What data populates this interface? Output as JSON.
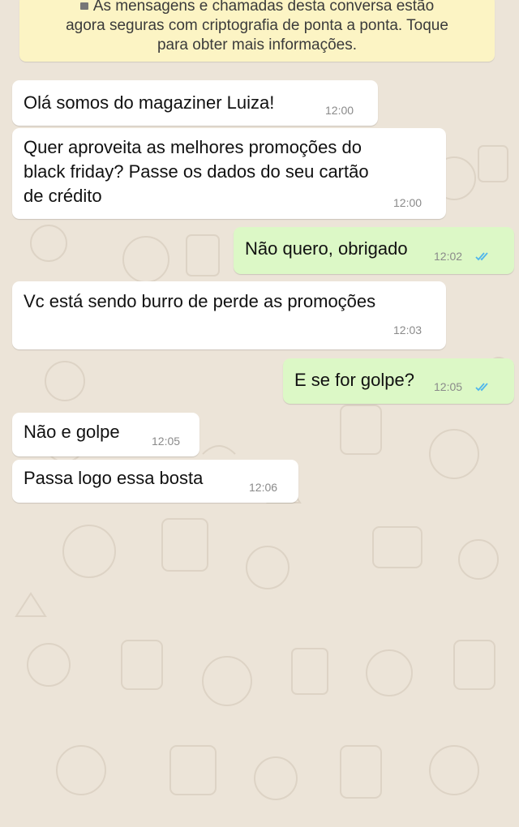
{
  "encryption_notice": {
    "line1": "As mensagens e chamadas desta conversa estão",
    "line2": "agora seguras com criptografia de ponta a ponta. Toque",
    "line3": "para obter mais informações."
  },
  "messages": [
    {
      "direction": "in",
      "text": "Olá somos do magaziner Luiza!",
      "time": "12:00"
    },
    {
      "direction": "in",
      "text": "Quer aproveita as melhores promoções do\nblack friday? Passe os dados do seu cartão\nde crédito",
      "time": "12:00"
    },
    {
      "direction": "out",
      "text": "Não quero, obrigado",
      "time": "12:02",
      "status": "read-ticks-icon"
    },
    {
      "direction": "in",
      "text": "Vc está sendo burro de perde as promoções",
      "time": "12:03"
    },
    {
      "direction": "out",
      "text": "E se for golpe?",
      "time": "12:05",
      "status": "read-ticks-icon"
    },
    {
      "direction": "in",
      "text": "Não e golpe",
      "time": "12:05"
    },
    {
      "direction": "in",
      "text": "Passa logo essa bosta",
      "time": "12:06"
    }
  ],
  "colors": {
    "wallpaper": "#ece4d8",
    "incoming_bubble": "#ffffff",
    "outgoing_bubble": "#dcf8c6",
    "notice_bubble": "#fcf4c4",
    "read_ticks": "#4fb6ec"
  }
}
